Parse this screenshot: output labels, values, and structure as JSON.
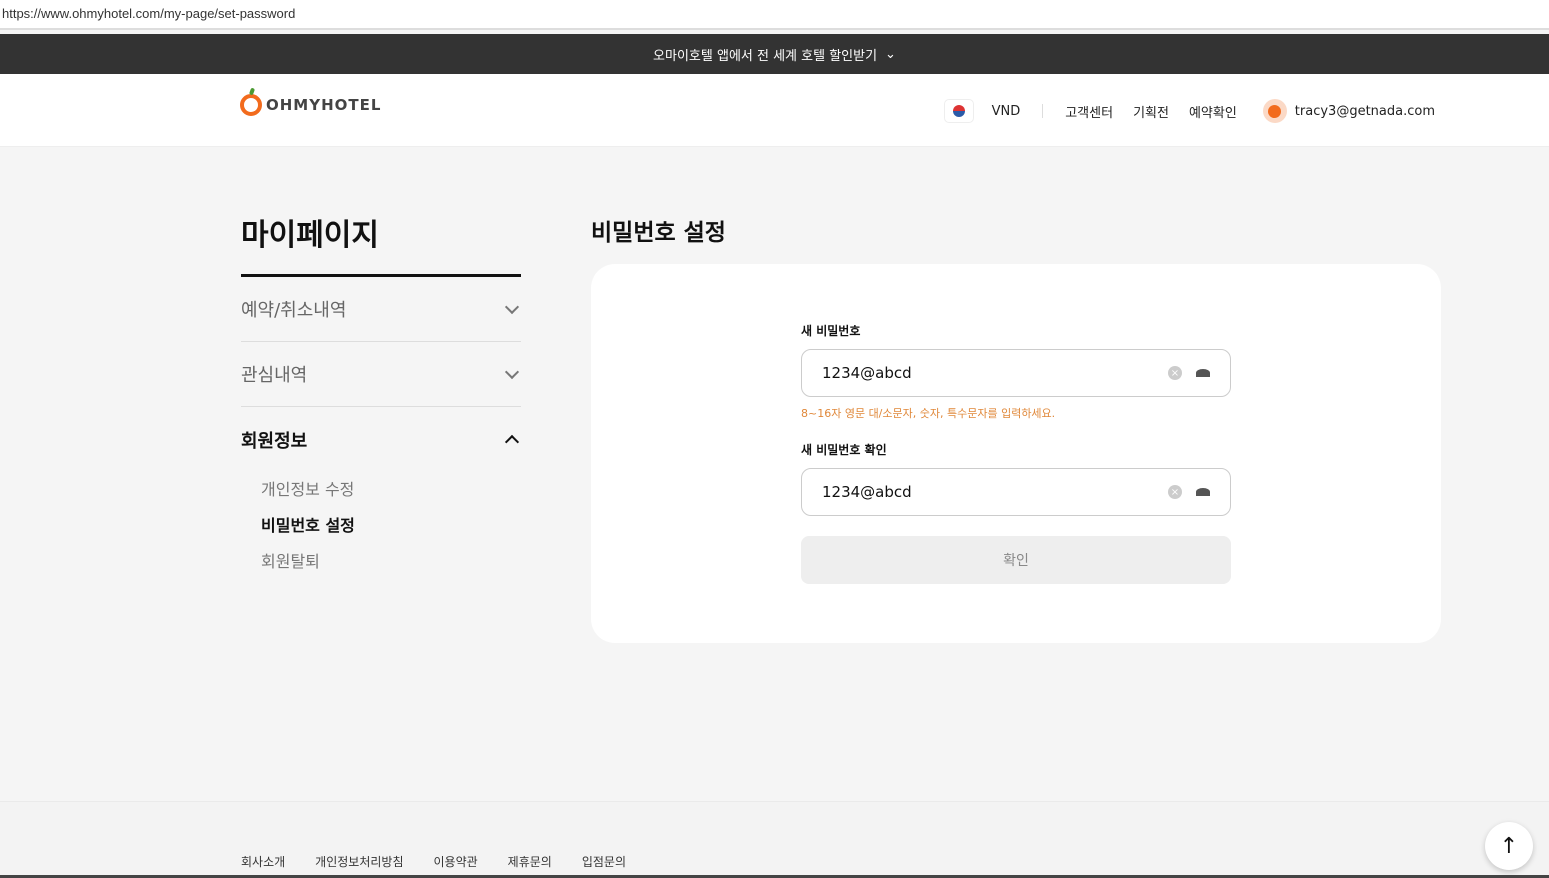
{
  "url": "https://www.ohmyhotel.com/my-page/set-password",
  "banner": {
    "text": "오마이호텔 앱에서 전 세계 호텔 할인받기"
  },
  "header": {
    "logo": "OHMYHOTEL",
    "currency": "VND",
    "links": [
      "고객센터",
      "기획전",
      "예약확인"
    ],
    "user": "tracy3@getnada.com"
  },
  "sidebar": {
    "title": "마이페이지",
    "menus": [
      {
        "label": "예약/취소내역"
      },
      {
        "label": "관심내역"
      },
      {
        "label": "회원정보"
      }
    ],
    "sub": [
      "개인정보 수정",
      "비밀번호 설정",
      "회원탈퇴"
    ]
  },
  "main": {
    "title": "비밀번호 설정",
    "new_label": "새 비밀번호",
    "new_value": "1234@abcd",
    "hint": "8~16자 영문 대/소문자, 숫자, 특수문자를 입력하세요.",
    "confirm_label": "새 비밀번호 확인",
    "confirm_value": "1234@abcd",
    "submit": "확인"
  },
  "footer": {
    "links": [
      "회사소개",
      "개인정보처리방침",
      "이용약관",
      "제휴문의",
      "입점문의"
    ]
  }
}
